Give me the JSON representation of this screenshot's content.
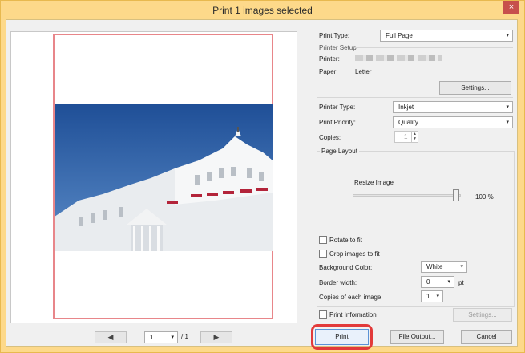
{
  "window": {
    "title": "Print  1 images selected",
    "close_glyph": "×"
  },
  "preview": {
    "prev_glyph": "◀",
    "next_glyph": "▶",
    "current_page": "1",
    "total_pages": "/  1",
    "dropdown_glyph": "▾"
  },
  "settings": {
    "print_type": {
      "label": "Print Type:",
      "value": "Full Page"
    },
    "printer_setup": {
      "group_label": "Printer Setup",
      "printer_label": "Printer:",
      "paper_label": "Paper:",
      "paper_value": "Letter",
      "settings_button": "Settings..."
    },
    "printer_type": {
      "label": "Printer Type:",
      "value": "Inkjet"
    },
    "print_priority": {
      "label": "Print Priority:",
      "value": "Quality"
    },
    "copies": {
      "label": "Copies:",
      "value": "1"
    },
    "page_layout": {
      "group_label": "Page Layout",
      "resize_label": "Resize Image",
      "resize_value": "100 %",
      "resize_fraction": 1.0,
      "rotate_label": "Rotate to fit",
      "crop_label": "Crop images to fit",
      "background_color_label": "Background Color:",
      "background_color_value": "White",
      "border_width_label": "Border width:",
      "border_width_value": "0",
      "border_width_unit": "pt",
      "copies_each_label": "Copies of each image:",
      "copies_each_value": "1"
    },
    "print_information": {
      "label": "Print Information",
      "settings_button": "Settings..."
    }
  },
  "footer": {
    "print": "Print",
    "file_output": "File Output...",
    "cancel": "Cancel"
  },
  "colors": {
    "accent_highlight": "#e23a3a",
    "page_border": "#e8868a",
    "title_bar": "#fdd98a"
  }
}
